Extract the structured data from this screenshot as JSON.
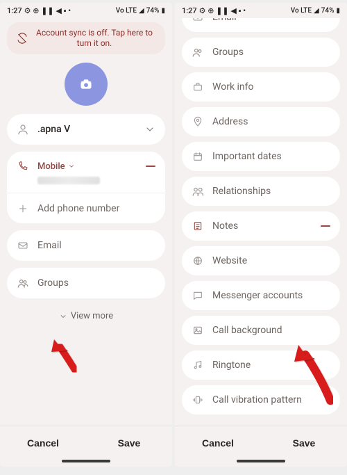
{
  "status": {
    "time": "1:27",
    "battery": "74%",
    "net": "Vo LTE"
  },
  "banner": "Account sync is off. Tap here to turn it on.",
  "left": {
    "name": ".apna V",
    "phoneType": "Mobile",
    "addPhone": "Add phone number",
    "email": "Email",
    "groups": "Groups",
    "viewMore": "View more"
  },
  "right": {
    "emailPeek": "Email",
    "groups": "Groups",
    "workInfo": "Work info",
    "address": "Address",
    "dates": "Important dates",
    "relationships": "Relationships",
    "notes": "Notes",
    "website": "Website",
    "messenger": "Messenger accounts",
    "callBg": "Call background",
    "ringtone": "Ringtone",
    "vibration": "Call vibration pattern"
  },
  "footer": {
    "cancel": "Cancel",
    "save": "Save"
  }
}
